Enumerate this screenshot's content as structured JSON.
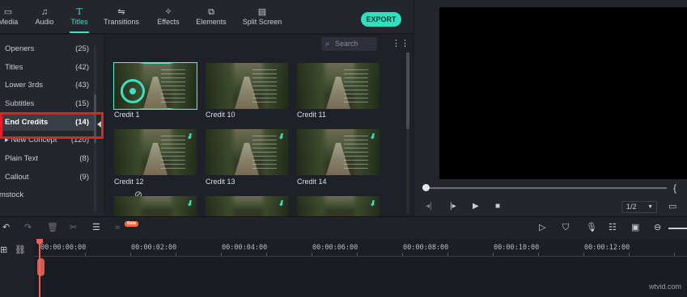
{
  "tabs": [
    {
      "label": "Media",
      "icon": "folder-icon"
    },
    {
      "label": "Audio",
      "icon": "music-note-icon"
    },
    {
      "label": "Titles",
      "icon": "text-t-icon",
      "active": true
    },
    {
      "label": "Transitions",
      "icon": "transitions-icon"
    },
    {
      "label": "Effects",
      "icon": "effects-sparkle-icon"
    },
    {
      "label": "Elements",
      "icon": "elements-icon"
    },
    {
      "label": "Split Screen",
      "icon": "split-screen-icon"
    }
  ],
  "export_label": "EXPORT",
  "sidebar": {
    "items": [
      {
        "label": "Openers",
        "count": "(25)"
      },
      {
        "label": "Titles",
        "count": "(42)"
      },
      {
        "label": "Lower 3rds",
        "count": "(43)"
      },
      {
        "label": "Subtitles",
        "count": "(15)"
      },
      {
        "label": "End Credits",
        "count": "(14)",
        "selected": true
      },
      {
        "label": "▸ New Concept",
        "count": "(120)"
      },
      {
        "label": "Plain Text",
        "count": "(8)"
      },
      {
        "label": "Callout",
        "count": "(9)"
      },
      {
        "label": "mstock",
        "count": ""
      }
    ]
  },
  "search": {
    "placeholder": "Search"
  },
  "thumbnails": [
    {
      "caption": "Credit 1",
      "selected": true
    },
    {
      "caption": "Credit 10"
    },
    {
      "caption": "Credit 11"
    },
    {
      "caption": "Credit 12",
      "download": true
    },
    {
      "caption": "Credit 13",
      "download": true
    },
    {
      "caption": "Credit 14",
      "download": true
    },
    {
      "caption": "",
      "download": true
    },
    {
      "caption": "",
      "download": true
    },
    {
      "caption": "",
      "download": true
    }
  ],
  "preview": {
    "ratio": "1/2",
    "brace": "{"
  },
  "timeline": {
    "timecodes": [
      "00:00:00:00",
      "00:00:02:00",
      "00:00:04:00",
      "00:00:06:00",
      "00:00:08:00",
      "00:00:10:00",
      "00:00:12:00"
    ],
    "beta_label": "Beta"
  },
  "watermark": "wtvid.com",
  "colors": {
    "accent": "#3ee0c5",
    "highlight_box": "#e0202a",
    "playhead": "#ef5a5a",
    "export_bg": "#2fe0bf"
  }
}
